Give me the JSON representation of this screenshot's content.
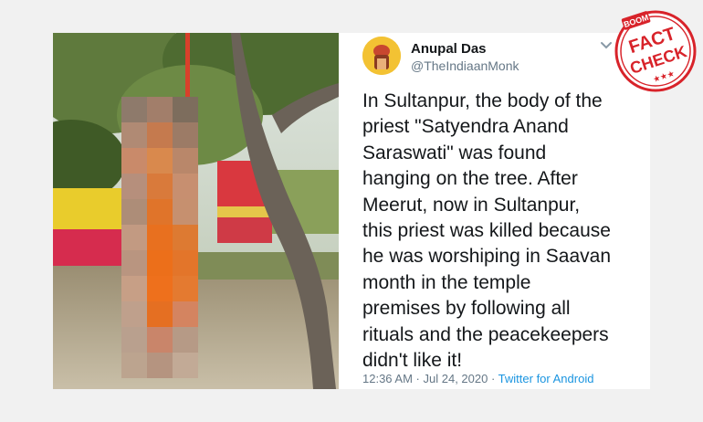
{
  "tweet": {
    "display_name": "Anupal Das",
    "handle": "@TheIndiaanMonk",
    "text": "In Sultanpur, the body of the\npriest \"Satyendra Anand\nSaraswati\" was found\nhanging on the tree. After\nMeerut, now in Sultanpur,\nthis priest was killed because\nhe was worshiping in Saavan\nmonth in the temple\npremises by following all\nrituals and the peacekeepers\ndidn't like it!",
    "time": "12:36 AM",
    "separator1": " · ",
    "date": "Jul 24, 2020",
    "separator2": " · ",
    "source": "Twitter for Android"
  },
  "stamp": {
    "brand": "BOOM",
    "line1": "FACT",
    "line2": "CHECK",
    "stars": "★★★"
  },
  "colors": {
    "background": "#f1f1f1",
    "card": "#ffffff",
    "text": "#14171a",
    "muted": "#657786",
    "link": "#1b95e0",
    "stamp_red": "#d8232a",
    "avatar": "#f3c233"
  },
  "icons": {
    "chevron": "chevron-down-icon"
  }
}
